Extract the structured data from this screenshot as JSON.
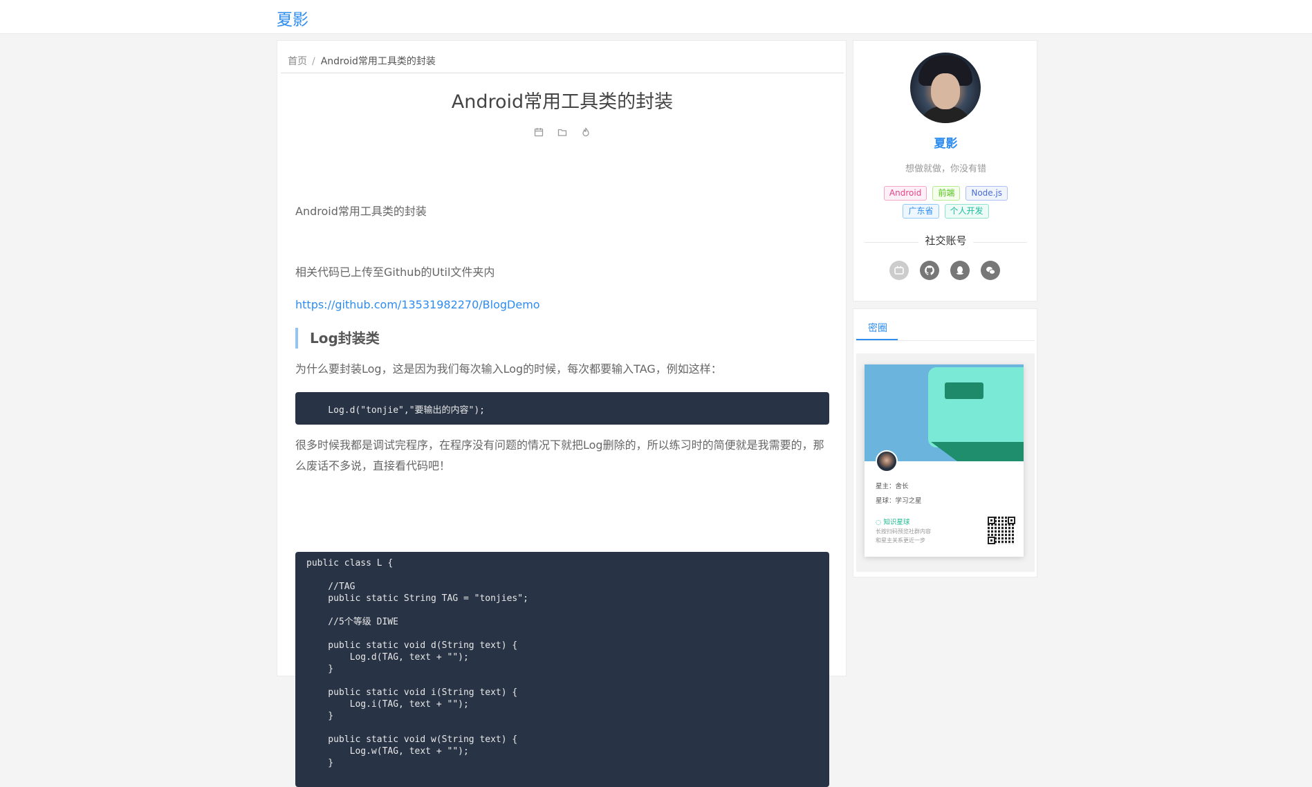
{
  "site": {
    "brand": "夏影"
  },
  "breadcrumb": {
    "home": "首页",
    "separator": "/",
    "current": "Android常用工具类的封装"
  },
  "article": {
    "title": "Android常用工具类的封装",
    "meta_icons": [
      "calendar-icon",
      "folder-icon",
      "fire-icon"
    ],
    "intro": "Android常用工具类的封装",
    "upload_note": "相关代码已上传至Github的Util文件夹内",
    "repo_link": "https://github.com/13531982270/BlogDemo",
    "section_title": "Log封装类",
    "why_text": "为什么要封装Log，这是因为我们每次输入Log的时候，每次都要输入TAG，例如这样：",
    "code_snippet_1": "    Log.d(\"tonjie\",\"要输出的内容\");",
    "explain_text": "很多时候我都是调试完程序，在程序没有问题的情况下就把Log删除的，所以练习时的简便就是我需要的，那么废话不多说，直接看代码吧！",
    "code_snippet_2": "public class L {\n\n    //TAG\n    public static String TAG = \"tonjies\";\n\n    //5个等级 DIWE\n\n    public static void d(String text) {\n        Log.d(TAG, text + \"\");\n    }\n\n    public static void i(String text) {\n        Log.i(TAG, text + \"\");\n    }\n\n    public static void w(String text) {\n        Log.w(TAG, text + \"\");\n    }"
  },
  "profile": {
    "name": "夏影",
    "motto": "想做就做，你没有错",
    "tags": [
      {
        "label": "Android",
        "color": "#e8428a"
      },
      {
        "label": "前端",
        "color": "#52c41a"
      },
      {
        "label": "Node.js",
        "color": "#4a6bd6"
      },
      {
        "label": "广东省",
        "color": "#2d8cf0"
      },
      {
        "label": "个人开发",
        "color": "#19be9b"
      }
    ],
    "social_title": "社交账号",
    "social_icons": [
      "bilibili-icon",
      "github-icon",
      "qq-icon",
      "wechat-icon"
    ]
  },
  "circle": {
    "tab_label": "密圈",
    "card": {
      "owner": "星主：舍长",
      "planet": "星球：学习之星",
      "brand": "知识星球",
      "line1": "长按扫码预览社群内容",
      "line2": "和星主关系更近一步"
    }
  }
}
